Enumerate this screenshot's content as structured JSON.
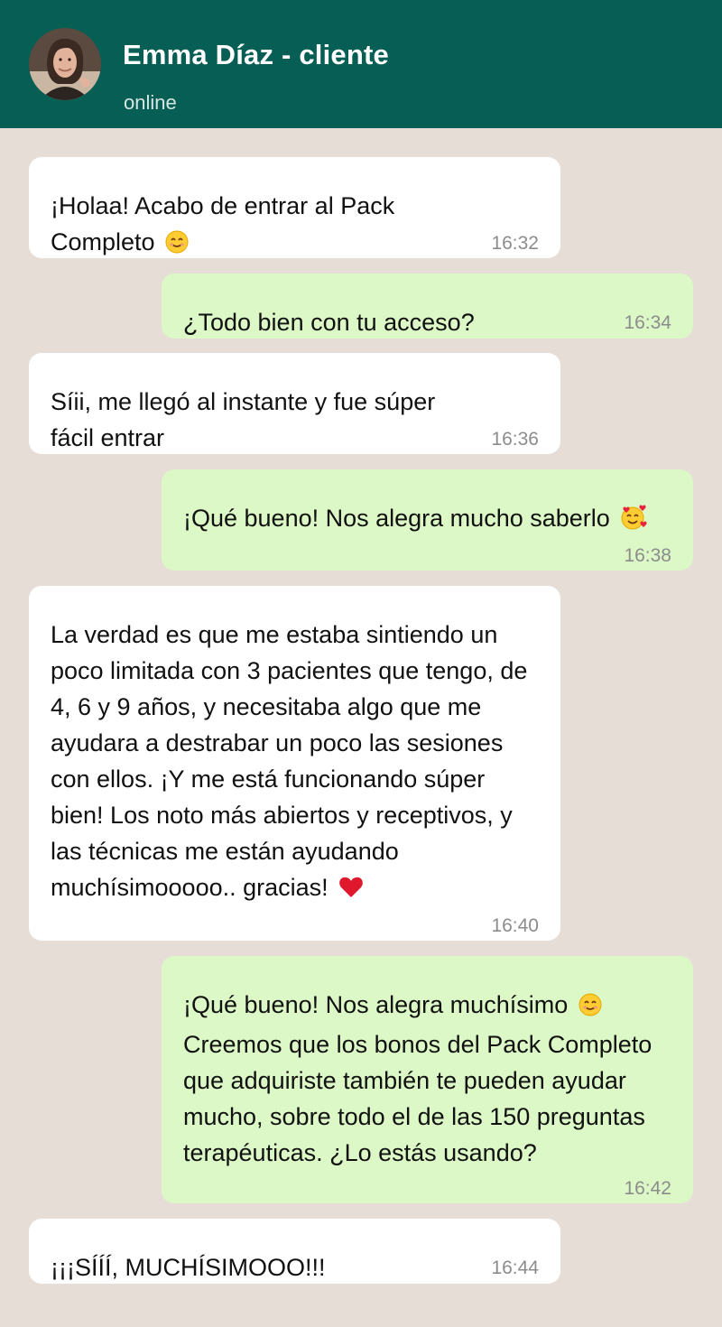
{
  "header": {
    "contact_name": "Emma Díaz - cliente",
    "status": "online",
    "avatar_icon": "person-avatar-icon",
    "background_color": "#075E54"
  },
  "messages": [
    {
      "direction": "incoming",
      "text": "¡Holaa! Acabo de entrar al Pack Completo",
      "emoji": "smiling-face-icon",
      "time": "16:32"
    },
    {
      "direction": "outgoing",
      "text": "¿Todo bien con tu acceso?",
      "time": "16:34"
    },
    {
      "direction": "incoming",
      "text": "Síii, me llegó al instante y fue súper fácil entrar",
      "time": "16:36"
    },
    {
      "direction": "outgoing",
      "text": "¡Qué bueno! Nos alegra mucho saberlo",
      "emoji": "smiling-face-with-hearts-icon",
      "time": "16:38"
    },
    {
      "direction": "incoming",
      "text": "La verdad es que me estaba sintiendo un poco limitada con 3 pacientes que tengo, de 4, 6 y 9 años, y necesitaba algo que me ayudara a destrabar un poco las sesiones con ellos. ¡Y me está funcionando súper bien! Los noto más abiertos y receptivos, y las técnicas me están ayudando muchísimooooo.. gracias!",
      "emoji": "red-heart-icon",
      "time": "16:40"
    },
    {
      "direction": "outgoing",
      "text_part1": "¡Qué bueno! Nos alegra muchísimo",
      "emoji": "smiling-face-icon",
      "text_part2": "Creemos que los bonos del Pack Completo que adquiriste también te pueden ayudar mucho, sobre todo el de las 150 preguntas terapéuticas. ¿Lo estás usando?",
      "time": "16:42"
    },
    {
      "direction": "incoming",
      "text": "¡¡¡SÍÍÍ, MUCHÍSIMOOO!!!",
      "time": "16:44"
    }
  ],
  "colors": {
    "chat_background": "#E6DDD6",
    "incoming_bubble": "#FFFFFF",
    "outgoing_bubble": "#DCF8C6",
    "timestamp": "#8C8C8C"
  }
}
